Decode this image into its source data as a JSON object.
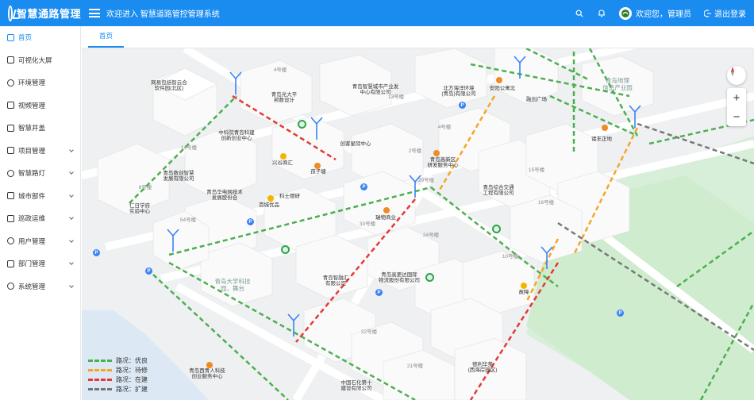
{
  "header": {
    "app_title": "智慧通路管理",
    "welcome_text": "欢迎进入 智慧道路管控管理系统",
    "user_greeting": "欢迎您，管理员",
    "logout_label": "退出登录",
    "colors": {
      "primary": "#1a8cf0"
    }
  },
  "sidebar": {
    "items": [
      {
        "label": "首页",
        "icon": "home-icon",
        "active": true,
        "expandable": false
      },
      {
        "label": "可视化大屏",
        "icon": "screen-icon",
        "active": false,
        "expandable": false
      },
      {
        "label": "环境管理",
        "icon": "environment-icon",
        "active": false,
        "expandable": false
      },
      {
        "label": "视频管理",
        "icon": "video-icon",
        "active": false,
        "expandable": false
      },
      {
        "label": "智慧井盖",
        "icon": "manhole-icon",
        "active": false,
        "expandable": false
      },
      {
        "label": "项目管理",
        "icon": "project-icon",
        "active": false,
        "expandable": true
      },
      {
        "label": "智慧路灯",
        "icon": "lamp-icon",
        "active": false,
        "expandable": true
      },
      {
        "label": "城市部件",
        "icon": "city-parts-icon",
        "active": false,
        "expandable": true
      },
      {
        "label": "巡政运维",
        "icon": "maintenance-icon",
        "active": false,
        "expandable": true
      },
      {
        "label": "用户管理",
        "icon": "user-icon",
        "active": false,
        "expandable": true
      },
      {
        "label": "部门管理",
        "icon": "department-icon",
        "active": false,
        "expandable": true
      },
      {
        "label": "系统管理",
        "icon": "settings-icon",
        "active": false,
        "expandable": true
      }
    ]
  },
  "tabs": [
    {
      "label": "首页",
      "active": true
    }
  ],
  "map": {
    "labels": [
      "网易包括智云合\n软件园(北区)",
      "青岛光大平\n邦数设计",
      "青岛智慧城市产业发\n中心有限公司",
      "北方海洋环境\n(青岛)有限公司",
      "青岛地理\n信息产业园",
      "安阳公寓北",
      "融创广场",
      "诸丰正地",
      "中科院青岛科建\n创新创业中心",
      "创客星际中心",
      "青岛高新区\n研发服务中心",
      "青岛综合交通\n工程有限公司",
      "兴谷商汇",
      "孩子塘",
      "科士德研",
      "青岛数创智慧\n发展有限公司",
      "青岛华电网技术\n发展股份合",
      "百城优品",
      "仁日学府\n实验中心",
      "瑞物商业",
      "青岛智融汇\n有限公司",
      "青岛高更达国际\n物流股份有限公司",
      "故障",
      "青岛大学科技\n园，舞台",
      "青岛西青人科技\n创业服务中心",
      "中国石化第十\n建设有限公司",
      "德利华美\n(西海岸园区)"
    ],
    "building_numbers": [
      "4号楼",
      "13号楼",
      "14号楼",
      "6号楼",
      "20号楼",
      "54号楼",
      "33号楼",
      "24号楼",
      "15号楼",
      "16号楼",
      "10号楼",
      "22号楼",
      "21号楼",
      "2号楼",
      "4号楼"
    ],
    "legend": [
      {
        "label": "路况：优良",
        "color": "#4caf50"
      },
      {
        "label": "路况：待修",
        "color": "#f5a623"
      },
      {
        "label": "路况：在建",
        "color": "#e53935"
      },
      {
        "label": "路况：扩建",
        "color": "#777777"
      }
    ],
    "controls": {
      "zoom_in": "+",
      "zoom_out": "−"
    }
  }
}
